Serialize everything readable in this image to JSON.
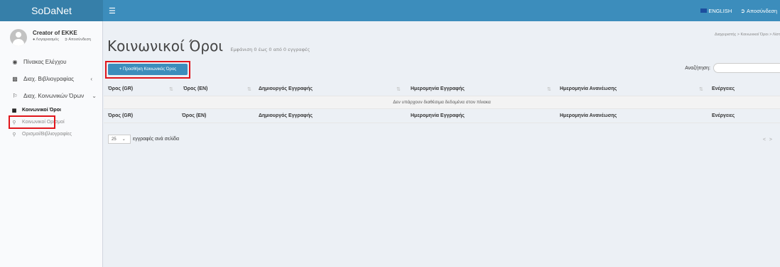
{
  "app": {
    "brand": "SoDaNet"
  },
  "header": {
    "menu_icon": "hamburger-icon",
    "language_label": "ENGLISH",
    "signout_label": "Αποσύνδεση"
  },
  "sidebar": {
    "user_name": "Creator of EKKE",
    "user_profile_link": "Λογαριασμός",
    "user_signout_link": "Αποσύνδεση",
    "items": [
      {
        "label": "Πίνακας Ελέγχου",
        "icon": "dashboard-icon"
      },
      {
        "label": "Διαχ. Βιβλιογραφίας",
        "icon": "book-icon"
      },
      {
        "label": "Διαχ. Κοινωνικών Όρων",
        "icon": "flag-icon"
      }
    ],
    "sub_items": [
      {
        "label": "Κοινωνικοί Όροι",
        "icon": "book-icon",
        "active": true
      },
      {
        "label": "Κοινωνικοί Ορισμοί",
        "icon": "pin-icon"
      },
      {
        "label": "Ορισμοί/Βιβλιογραφίες",
        "icon": "pin-icon"
      }
    ]
  },
  "main": {
    "breadcrumb": "Διαχειριστής  >  Κοινωνικοί Όροι  >  Λίστ",
    "title": "Κοινωνικοί Όροι",
    "subtitle": "Εμφάνιση 0 έως 0 από 0 εγγραφές",
    "add_button_label": "+ Προσθήκη Κοινωνικός Όρος",
    "search_label": "Αναζήτηση:",
    "search_value": "",
    "columns": [
      "Όρος (GR)",
      "Όρος (EN)",
      "Δημιουργός Εγγραφής",
      "Ημερομηνία Εγγραφής",
      "Ημερομηνία Ανανέωσης",
      "Ενέργειες"
    ],
    "empty_message": "Δεν υπάρχουν διαθέσιμα δεδομένα στον πίνακα",
    "page_size_value": "25",
    "page_size_label": "εγγραφές ανά σελίδα",
    "pager_prev": "<",
    "pager_next": ">"
  },
  "colors": {
    "header": "#3c8dbc",
    "logo": "#367fa9",
    "highlight": "#e0151b"
  }
}
